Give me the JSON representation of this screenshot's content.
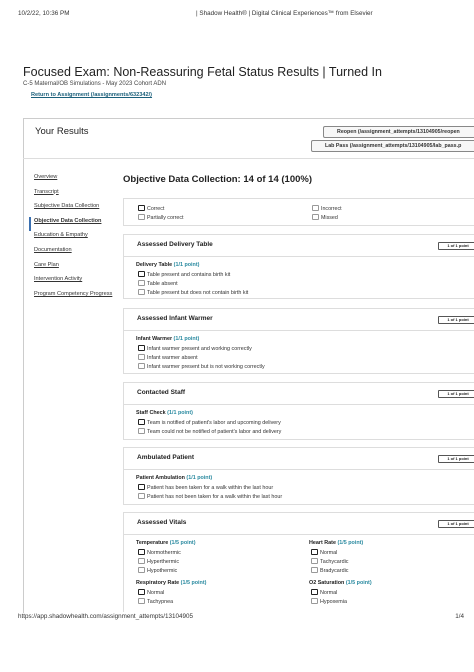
{
  "print_header": {
    "date": "10/2/22, 10:36 PM",
    "title": "| Shadow Health® | Digital Clinical Experiences™ from Elsevier"
  },
  "print_footer": {
    "url": "https://app.shadowhealth.com/assignment_attempts/13104905",
    "page": "1/4"
  },
  "page": {
    "title": "Focused Exam: Non-Reassuring Fetal Status Results | Turned In",
    "subtitle": "C-5 Maternal/OB Simulations - May 2023 Cohort ADN",
    "return_link": "Return to Assignment (/assignments/632342/)"
  },
  "results": {
    "title": "Your Results",
    "reopen_button": "Reopen (/assignment_attempts/13104905/reopen",
    "lab_pass_button": "Lab Pass (/assignment_attempts/13104905/lab_pass.p"
  },
  "nav": [
    "Overview",
    "Transcript",
    "Subjective Data Collection",
    "Objective Data Collection",
    "Education & Empathy",
    "Documentation",
    "Care Plan",
    "Intervention Activity",
    "Program Competency Progress"
  ],
  "main": {
    "heading": "Objective Data Collection: 14 of 14 (100%)",
    "legend": {
      "correct": "Correct",
      "partially_correct": "Partially correct",
      "incorrect": "Incorrect",
      "missed": "Missed"
    },
    "sections": [
      {
        "title": "Assessed Delivery Table",
        "points": "1 of 1 point",
        "question": "Delivery Table",
        "question_points": "(1/1 point)",
        "options": [
          "Table present and contains birth kit",
          "Table absent",
          "Table present but does not contain birth kit"
        ]
      },
      {
        "title": "Assessed Infant Warmer",
        "points": "1 of 1 point",
        "question": "Infant Warmer",
        "question_points": "(1/1 point)",
        "options": [
          "Infant warmer present and working correctly",
          "Infant warmer absent",
          "Infant warmer present but is not working correctly"
        ]
      },
      {
        "title": "Contacted Staff",
        "points": "1 of 1 point",
        "question": "Staff Check",
        "question_points": "(1/1 point)",
        "options": [
          "Team is notified of patient's labor and upcoming delivery",
          "Team could not be notified of patient's labor and delivery"
        ]
      },
      {
        "title": "Ambulated Patient",
        "points": "1 of 1 point",
        "question": "Patient Ambulation",
        "question_points": "(1/1 point)",
        "options": [
          "Patient has been taken for a walk within the last hour",
          "Patient has not been taken for a walk within the last hour"
        ]
      },
      {
        "title": "Assessed Vitals",
        "points": "1 of 1 point",
        "groups": [
          {
            "question": "Temperature",
            "question_points": "(1/5 point)",
            "options": [
              "Normothermic",
              "Hyperthermic",
              "Hypothermic"
            ]
          },
          {
            "question": "Heart Rate",
            "question_points": "(1/5 point)",
            "options": [
              "Normal",
              "Tachycardic",
              "Bradycardic"
            ]
          },
          {
            "question": "Respiratory Rate",
            "question_points": "(1/5 point)",
            "options": [
              "Normal",
              "Tachypnea"
            ]
          },
          {
            "question": "O2 Saturation",
            "question_points": "(1/5 point)",
            "options": [
              "Normal",
              "Hypoxemia"
            ]
          }
        ]
      }
    ]
  }
}
